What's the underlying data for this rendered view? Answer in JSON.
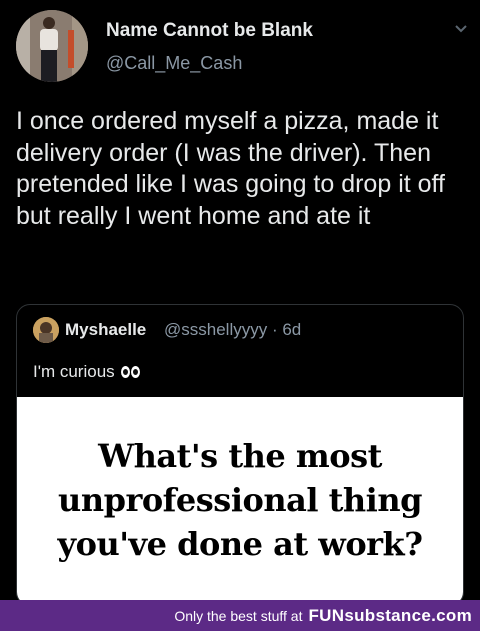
{
  "tweet": {
    "author_name": "Name Cannot be Blank",
    "author_handle": "@Call_Me_Cash",
    "text": "I once ordered myself a pizza, made it delivery order (I was the driver). Then pretended like I was going to drop it off but really I went home and ate it",
    "menu_icon": "chevron-down-icon"
  },
  "quoted": {
    "author_name": "Myshaelle",
    "author_handle": "@ssshellyyyy · 6d",
    "text": "I'm curious",
    "emoji_icon": "eyes-emoji-icon",
    "image_text_lines": [
      "What's the most",
      "unprofessional thing",
      "you've done at work?"
    ]
  },
  "footer": {
    "tagline": "Only the best stuff at",
    "brand": "FUNsubstance.com",
    "background": "#5c2a86"
  },
  "colors": {
    "background": "#000000",
    "text_primary": "#e7e9ea",
    "text_secondary": "#8b98a5"
  }
}
